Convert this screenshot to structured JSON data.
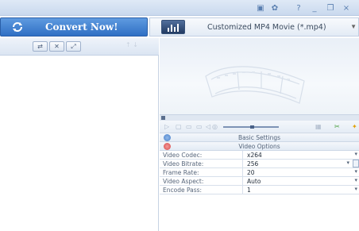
{
  "window": {
    "controls": [
      "▣",
      "✿",
      "?",
      "_",
      "❐",
      "×"
    ]
  },
  "toolbar": {
    "convert_label": "Convert Now!",
    "profile_label": "Customized MP4 Movie (*.mp4)",
    "dropdown_arrow": "▼"
  },
  "file_toolbar": {
    "buttons": [
      "⇄",
      "✕",
      "⤢"
    ],
    "faint_glyphs": "↑ ↓"
  },
  "player": {
    "progress": 0.0
  },
  "settings": {
    "basic_label": "Basic Settings",
    "video_label": "Video Options",
    "rows": [
      {
        "key": "Video Codec:",
        "value": "x264"
      },
      {
        "key": "Video Bitrate:",
        "value": "256"
      },
      {
        "key": "Frame Rate:",
        "value": "20"
      },
      {
        "key": "Video Aspect:",
        "value": "Auto"
      },
      {
        "key": "Encode Pass:",
        "value": "1"
      }
    ]
  },
  "icons": {
    "convert": "refresh-icon",
    "profile": "equalizer-icon",
    "basic": "globe-icon",
    "video": "film-icon"
  },
  "colors": {
    "convert_button": "#3a7bd0",
    "accent_blue": "#2f6fc4",
    "video_options_icon": "#e05a5a",
    "basic_settings_icon": "#4a7fc9"
  }
}
